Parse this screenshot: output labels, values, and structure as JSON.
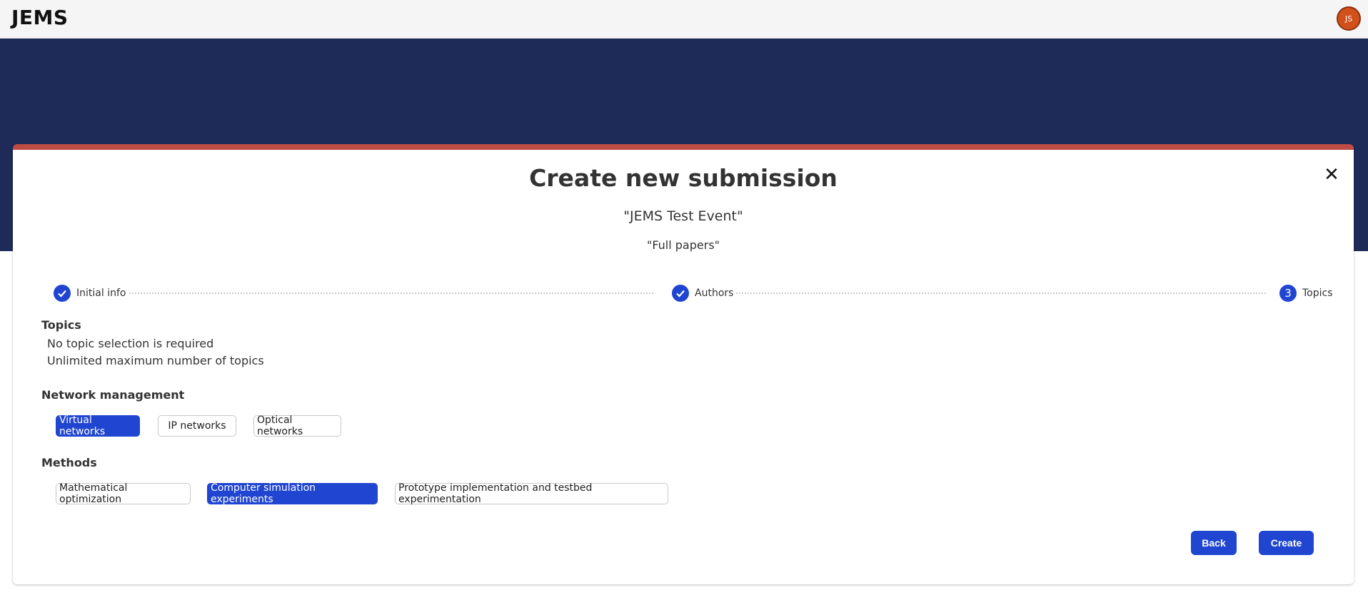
{
  "app": {
    "logo": "JEMS",
    "user_initials": "JS"
  },
  "dialog": {
    "title": "Create new submission",
    "event": "\"JEMS Test Event\"",
    "track": "\"Full papers\"",
    "close_icon": "close-icon"
  },
  "stepper": {
    "steps": [
      {
        "label": "Initial info",
        "state": "done",
        "icon": "check-icon"
      },
      {
        "label": "Authors",
        "state": "done",
        "icon": "check-icon"
      },
      {
        "label": "Topics",
        "state": "current",
        "number": "3"
      }
    ]
  },
  "topics": {
    "heading": "Topics",
    "rules": [
      "No topic selection is required",
      "Unlimited maximum number of topics"
    ]
  },
  "groups": [
    {
      "title": "Network management",
      "options": [
        {
          "label": "Virtual networks",
          "selected": true
        },
        {
          "label": "IP networks",
          "selected": false
        },
        {
          "label": "Optical networks",
          "selected": false
        }
      ]
    },
    {
      "title": "Methods",
      "options": [
        {
          "label": "Mathematical optimization",
          "selected": false
        },
        {
          "label": "Computer simulation experiments",
          "selected": true
        },
        {
          "label": "Prototype implementation and testbed experimentation",
          "selected": false
        }
      ]
    }
  ],
  "actions": {
    "back": "Back",
    "create": "Create"
  },
  "colors": {
    "accent": "#1f45d1",
    "hero": "#1e2a58",
    "card_top": "#bf4b45",
    "avatar": "#d2511a"
  }
}
